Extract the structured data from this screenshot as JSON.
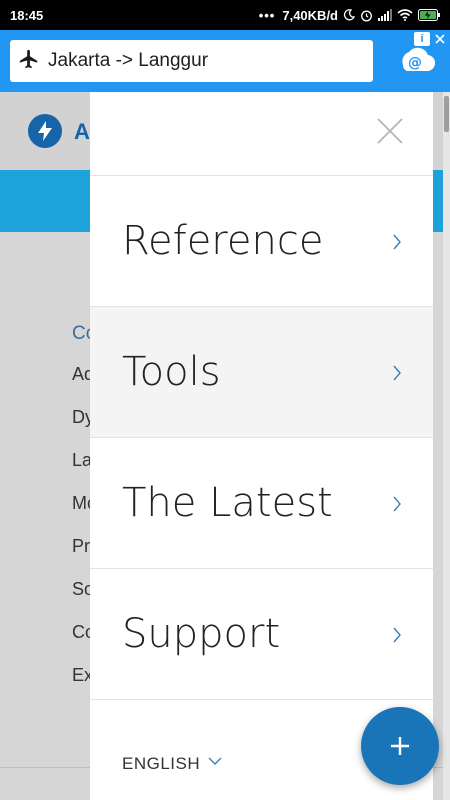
{
  "status_bar": {
    "time": "18:45",
    "network_speed": "7,40KB/d",
    "icons": [
      "moon-icon",
      "alarm-icon",
      "signal-icon",
      "wifi-icon",
      "battery-charging-icon"
    ]
  },
  "ad": {
    "destination_text": "Jakarta -> Langgur",
    "icon": "airplane-icon",
    "info_label": "i"
  },
  "background_page": {
    "brand_initial": "A",
    "list_heading": "Co",
    "list_items": [
      "Ad",
      "Dy",
      "La",
      "Mo",
      "Pr",
      "So",
      "Co",
      "Ex"
    ]
  },
  "drawer": {
    "menu_items": [
      {
        "label": "Reference"
      },
      {
        "label": "Tools"
      },
      {
        "label": "The Latest"
      },
      {
        "label": "Support"
      }
    ],
    "language_label": "ENGLISH"
  },
  "colors": {
    "accent": "#2196f3",
    "brand": "#1565a8",
    "fab": "#1a75b8"
  }
}
